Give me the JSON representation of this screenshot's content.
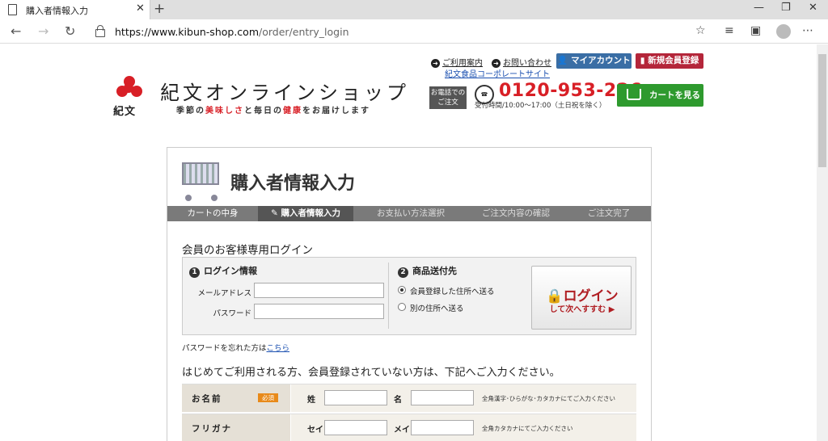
{
  "browser": {
    "tab_title": "購入者情報入力",
    "url_domain": "https://www.kibun-shop.com",
    "url_path": "/order/entry_login"
  },
  "header": {
    "logo_text": "紀文",
    "shop_name": "紀文オンラインショップ",
    "tagline_1": "季節の",
    "tagline_red1": "美味しさ",
    "tagline_2": "と毎日の",
    "tagline_red2": "健康",
    "tagline_3": "をお届けします",
    "link_guide": "ご利用案内",
    "link_contact": "お問い合わせ",
    "link_corporate": "紀文食品コーポレートサイト",
    "btn_mypage": "マイアカウント",
    "btn_register": "新規会員登録",
    "tel_label_1": "お電話での",
    "tel_label_2": "ご注文",
    "tel_number": "0120-953-226",
    "tel_hours": "受付時間/10:00〜17:00（土日祝を除く）",
    "btn_cart": "カートを見る"
  },
  "page": {
    "title": "購入者情報入力",
    "steps": [
      "カートの中身",
      "購入者情報入力",
      "お支払い方法選択",
      "ご注文内容の確認",
      "ご注文完了"
    ],
    "member_section_title": "会員のお客様専用ログイン",
    "login_info_heading": "ログイン情報",
    "login_info_num": "1",
    "email_label": "メールアドレス",
    "password_label": "パスワード",
    "email_value": "",
    "password_value": "",
    "ship_heading": "商品送付先",
    "ship_num": "2",
    "ship_opt1": "会員登録した住所へ送る",
    "ship_opt2": "別の住所へ送る",
    "login_btn_main": "ログイン",
    "login_btn_sub": "して次へすすむ ▶",
    "forgot_text": "パスワードを忘れた方は",
    "forgot_link": "こちら",
    "guest_heading": "はじめてご利用される方、会員登録されていない方は、下記へご入力ください。",
    "name_label": "お名前",
    "required_badge": "必須",
    "sei_label": "姓",
    "mei_label": "名",
    "name_note": "全角漢字･ひらがな･カタカナにてご入力ください",
    "furigana_label": "フリガナ",
    "sei_kana_label": "セイ",
    "mei_kana_label": "メイ",
    "furigana_note": "全角カタカナにてご入力ください"
  }
}
